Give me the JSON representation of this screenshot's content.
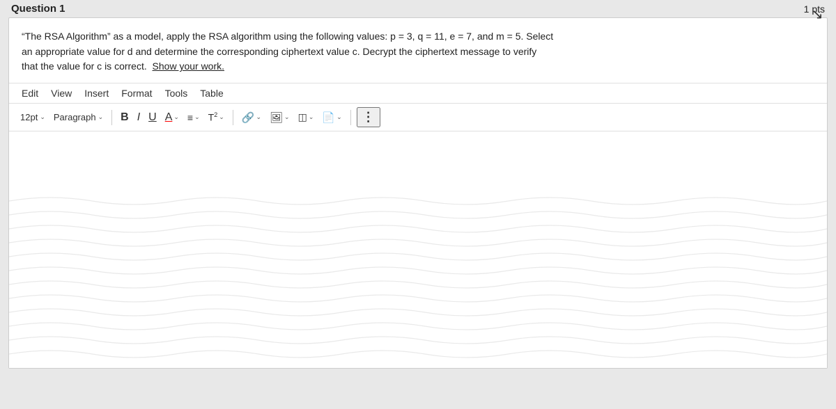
{
  "header": {
    "title": "Question 1",
    "pts": "1 pts"
  },
  "question": {
    "text_line1": "“The RSA Algorithm” as a model, apply the RSA algorithm using the following values: p = 3, q = 11, e = 7, and m = 5. Select",
    "text_line2": "an appropriate value for d and determine the corresponding ciphertext value c. Decrypt the ciphertext message to verify",
    "text_line3": "that the value for c is correct.",
    "show_work": "Show your work."
  },
  "menu": {
    "items": [
      "Edit",
      "View",
      "Insert",
      "Format",
      "Tools",
      "Table"
    ]
  },
  "toolbar": {
    "font_size": "12pt",
    "font_size_chevron": "⌄",
    "paragraph": "Paragraph",
    "paragraph_chevron": "⌄",
    "bold": "B",
    "italic": "I",
    "underline": "U",
    "font_color": "A",
    "indent": "≡",
    "superscript": "T",
    "sup_num": "2",
    "link": "🔗",
    "image": "🖼",
    "more1": "⋮",
    "table_icon": "≡",
    "clipboard": "📋"
  }
}
